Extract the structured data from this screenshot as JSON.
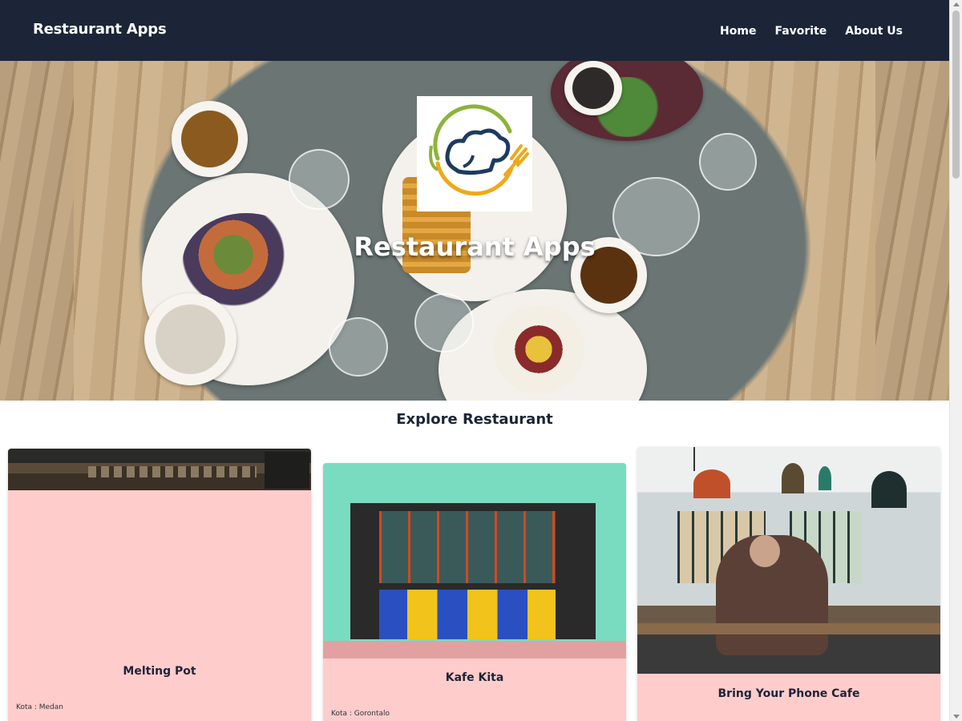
{
  "navbar": {
    "brand": "Restaurant Apps",
    "links": [
      "Home",
      "Favorite",
      "About Us"
    ]
  },
  "hero": {
    "title": "Restaurant Apps",
    "logo_icon": "chef-hat-fork-logo"
  },
  "explore": {
    "title": "Explore Restaurant"
  },
  "restaurants": [
    {
      "name": "Melting Pot",
      "city": "Kota : Medan"
    },
    {
      "name": "Kafe Kita",
      "city": "Kota : Gorontalo"
    },
    {
      "name": "Bring Your Phone Cafe",
      "city": ""
    }
  ],
  "colors": {
    "navbar_bg": "#1b2537",
    "card_bg": "#ffcccc",
    "heading": "#1b2537",
    "logo_green": "#8db33a",
    "logo_orange": "#f0a81a",
    "logo_navy": "#1c3b5e"
  }
}
